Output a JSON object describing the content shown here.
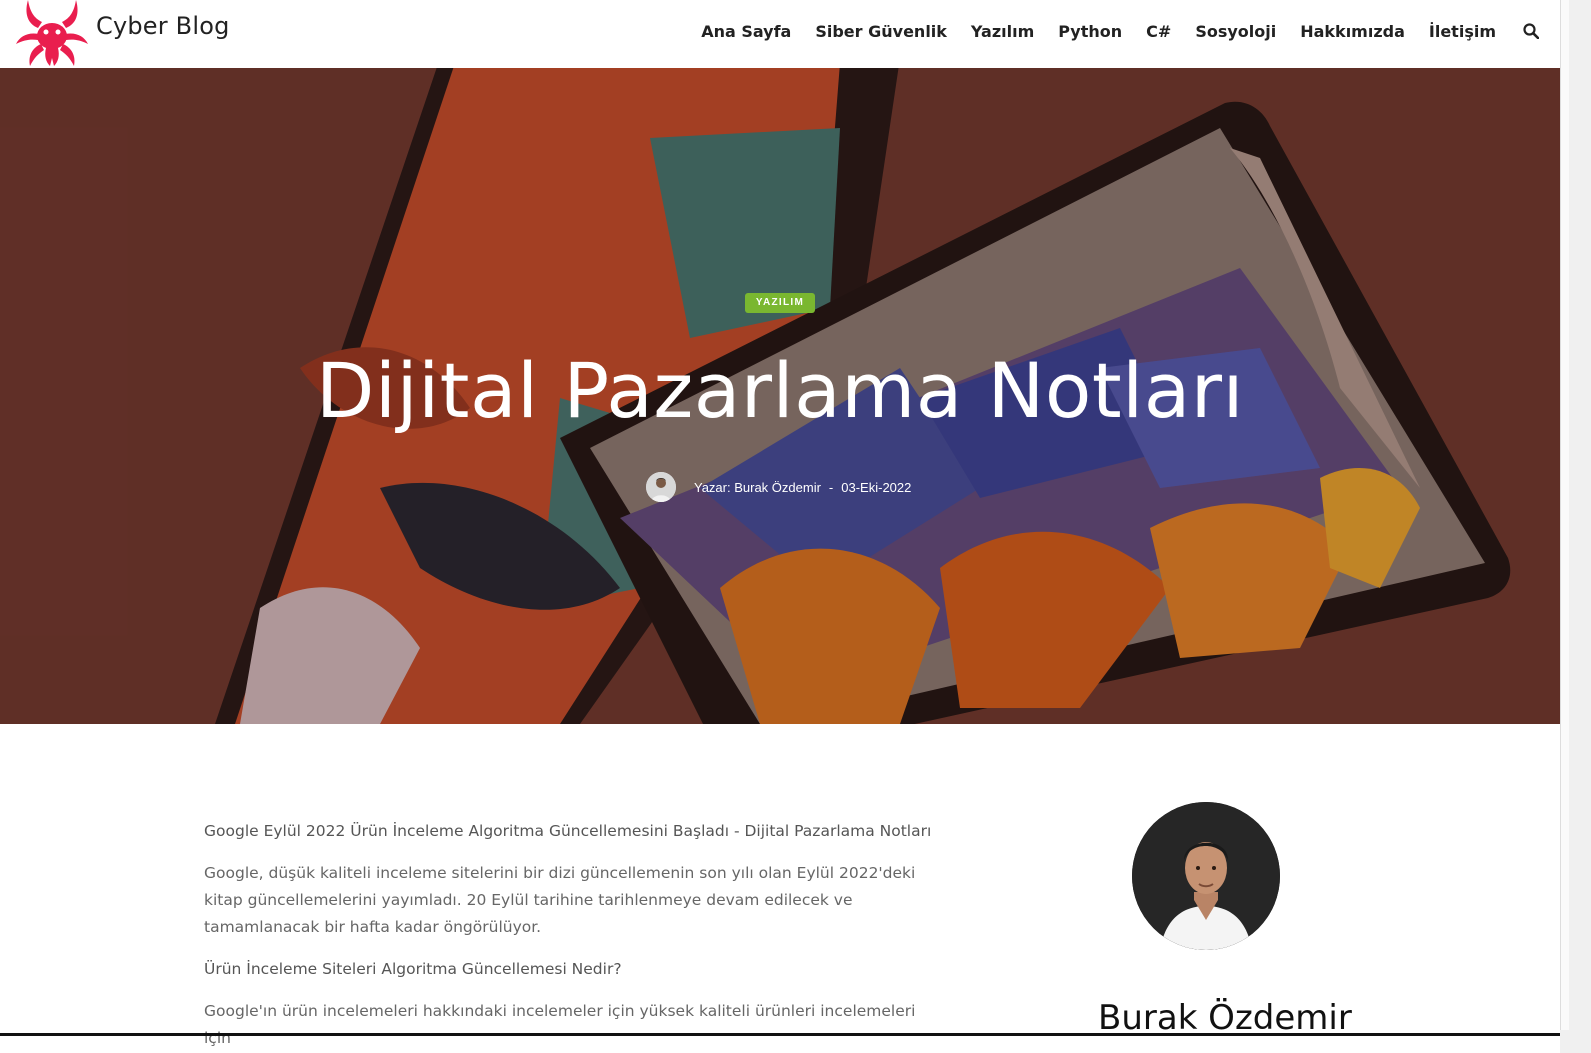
{
  "site": {
    "title": "Cyber Blog",
    "brand_color": "#e91e4e"
  },
  "nav": {
    "items": [
      "Ana Sayfa",
      "Siber Güvenlik",
      "Yazılım",
      "Python",
      "C#",
      "Sosyoloji",
      "Hakkımızda",
      "İletişim"
    ],
    "search_icon": "search-icon"
  },
  "hero": {
    "category": "YAZILIM",
    "category_color": "#7ab730",
    "title": "Dijital Pazarlama Notları",
    "author_line": "Yazar: Burak Özdemir",
    "separator": "-",
    "date": "03-Eki-2022"
  },
  "content": {
    "p1": "Google Eylül 2022 Ürün İnceleme Algoritma Güncellemesini Başladı - Dijital Pazarlama Notları",
    "p2": "Google, düşük kaliteli inceleme sitelerini bir dizi güncellemenin son yılı olan Eylül 2022'deki kitap güncellemelerini yayımladı. 20 Eylül tarihine tarihlenmeye devam edilecek ve tamamlanacak bir hafta kadar öngörülüyor.",
    "p3": "Ürün İnceleme Siteleri Algoritma Güncellemesi Nedir?",
    "p4": "Google'ın ürün incelemeleri hakkındaki incelemeler için yüksek kaliteli ürünleri incelemeleri için"
  },
  "sidebar": {
    "name": "Burak Özdemir"
  }
}
